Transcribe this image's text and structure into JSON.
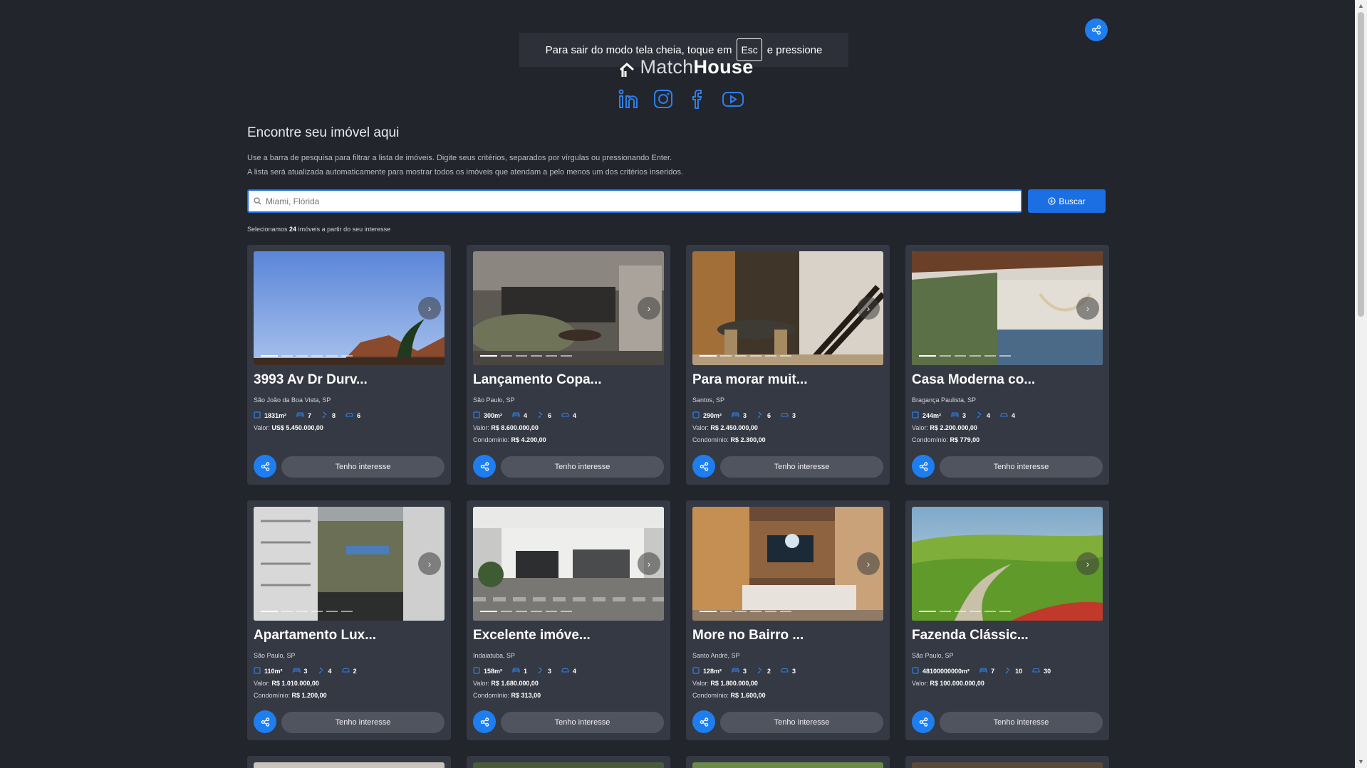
{
  "notice": {
    "before": "Para sair do modo tela cheia, toque em",
    "key": "Esc",
    "after": "e pressione"
  },
  "logo": {
    "light": "Match",
    "bold": "House"
  },
  "social": [
    "linkedin-icon",
    "instagram-icon",
    "facebook-icon",
    "youtube-icon"
  ],
  "section": {
    "heading": "Encontre seu imóvel aqui",
    "desc1": "Use a barra de pesquisa para filtrar a lista de imóveis. Digite seus critérios, separados por vírgulas ou pressionando Enter.",
    "desc2": "A lista será atualizada automaticamente para mostrar todos os imóveis que atendam a pelo menos um dos critérios inseridos."
  },
  "search": {
    "placeholder": "Miami, Flórida",
    "button": "Buscar"
  },
  "results": {
    "prefix": "Selecionamos",
    "count": "24",
    "suffix": "imóveis a partir do seu interesse"
  },
  "cards": [
    {
      "title": "3993 Av Dr Durv...",
      "location": "São João da Boa Vista, SP",
      "area": "1831m²",
      "bedrooms": "7",
      "bathrooms": "8",
      "parking": "6",
      "value_label": "Valor:",
      "value": "US$ 5.450.000,00",
      "condo_label": "",
      "condo": "",
      "button": "Tenho interesse"
    },
    {
      "title": "Lançamento Copa...",
      "location": "São Paulo, SP",
      "area": "300m²",
      "bedrooms": "4",
      "bathrooms": "6",
      "parking": "4",
      "value_label": "Valor:",
      "value": "R$ 8.600.000,00",
      "condo_label": "Condomínio:",
      "condo": "R$ 4.200,00",
      "button": "Tenho interesse"
    },
    {
      "title": "Para morar muit...",
      "location": "Santos, SP",
      "area": "290m²",
      "bedrooms": "3",
      "bathrooms": "6",
      "parking": "3",
      "value_label": "Valor:",
      "value": "R$ 2.450.000,00",
      "condo_label": "Condomínio:",
      "condo": "R$ 2.300,00",
      "button": "Tenho interesse"
    },
    {
      "title": "Casa Moderna co...",
      "location": "Bragança Paulista, SP",
      "area": "244m²",
      "bedrooms": "3",
      "bathrooms": "4",
      "parking": "4",
      "value_label": "Valor:",
      "value": "R$ 2.200.000,00",
      "condo_label": "Condomínio:",
      "condo": "R$ 779,00",
      "button": "Tenho interesse"
    },
    {
      "title": "Apartamento Lux...",
      "location": "São Paulo, SP",
      "area": "110m²",
      "bedrooms": "3",
      "bathrooms": "4",
      "parking": "2",
      "value_label": "Valor:",
      "value": "R$ 1.010.000,00",
      "condo_label": "Condomínio:",
      "condo": "R$ 1.200,00",
      "button": "Tenho interesse"
    },
    {
      "title": "Excelente imóve...",
      "location": "Indaiatuba, SP",
      "area": "158m²",
      "bedrooms": "1",
      "bathrooms": "3",
      "parking": "4",
      "value_label": "Valor:",
      "value": "R$ 1.680.000,00",
      "condo_label": "Condomínio:",
      "condo": "R$ 313,00",
      "button": "Tenho interesse"
    },
    {
      "title": "More no Bairro ...",
      "location": "Santo André, SP",
      "area": "128m²",
      "bedrooms": "3",
      "bathrooms": "2",
      "parking": "3",
      "value_label": "Valor:",
      "value": "R$ 1.800.000,00",
      "condo_label": "Condomínio:",
      "condo": "R$ 1.600,00",
      "button": "Tenho interesse"
    },
    {
      "title": "Fazenda Clássic...",
      "location": "São Paulo, SP",
      "area": "48100000000m²",
      "bedrooms": "7",
      "bathrooms": "10",
      "parking": "30",
      "value_label": "Valor:",
      "value": "R$ 100.000.000,00",
      "condo_label": "",
      "condo": "",
      "button": "Tenho interesse"
    }
  ],
  "colors": {
    "background": "#22252c",
    "card": "#353943",
    "accent": "#1e7ef0"
  }
}
